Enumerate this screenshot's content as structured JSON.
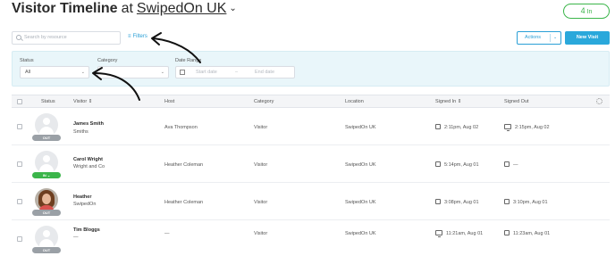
{
  "header": {
    "title_bold": "Visitor Timeline",
    "title_at": "at",
    "venue": "SwipedOn UK",
    "in_count": "4",
    "in_label": "In"
  },
  "toolbar": {
    "search_placeholder": "Search by resource",
    "filters_label": "Filters",
    "actions_label": "Actions",
    "new_visit_label": "New Visit"
  },
  "filters": {
    "status_label": "Status",
    "status_value": "All",
    "category_label": "Category",
    "category_value": "",
    "date_range_label": "Date Range",
    "start_date_placeholder": "Start date",
    "end_date_placeholder": "End date",
    "date_separator": "–"
  },
  "table": {
    "columns": [
      "Status",
      "Visitor",
      "Host",
      "Category",
      "Location",
      "Signed In",
      "Signed Out"
    ],
    "rows": [
      {
        "status": "OUT",
        "name": "James Smith",
        "company": "Smiths",
        "host": "Ava Thompson",
        "category": "Visitor",
        "location": "SwipedOn UK",
        "signed_in": "2:11pm, Aug 02",
        "signed_out": "2:15pm, Aug 02",
        "signed_in_icon": "tablet-icon",
        "signed_out_icon": "monitor-icon",
        "avatar": "default"
      },
      {
        "status": "IN",
        "name": "Carol Wright",
        "company": "Wright and Co",
        "host": "Heather Coleman",
        "category": "Visitor",
        "location": "SwipedOn UK",
        "signed_in": "5:14pm, Aug 01",
        "signed_out": "—",
        "signed_in_icon": "tablet-icon",
        "signed_out_icon": "tablet-icon",
        "avatar": "default"
      },
      {
        "status": "OUT",
        "name": "Heather",
        "company": "SwipedOn",
        "host": "Heather Coleman",
        "category": "Visitor",
        "location": "SwipedOn UK",
        "signed_in": "3:08pm, Aug 01",
        "signed_out": "3:10pm, Aug 01",
        "signed_in_icon": "tablet-icon",
        "signed_out_icon": "tablet-icon",
        "avatar": "photo"
      },
      {
        "status": "OUT",
        "name": "Tim Bloggs",
        "company": "—",
        "host": "—",
        "category": "Visitor",
        "location": "SwipedOn UK",
        "signed_in": "11:21am, Aug 01",
        "signed_out": "11:23am, Aug 01",
        "signed_in_icon": "monitor-icon",
        "signed_out_icon": "tablet-icon",
        "avatar": "default"
      }
    ]
  },
  "colors": {
    "accent": "#2aa8db",
    "in_green": "#3bb54a",
    "out_grey": "#9aa0a6",
    "filter_panel": "#e9f6fa"
  }
}
